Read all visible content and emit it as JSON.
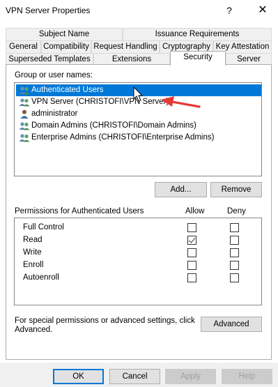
{
  "window": {
    "title": "VPN Server Properties",
    "help_glyph": "?",
    "close_glyph": "✕"
  },
  "tabs": {
    "row1": [
      "Subject Name",
      "Issuance Requirements"
    ],
    "row2": [
      "General",
      "Compatibility",
      "Request Handling",
      "Cryptography",
      "Key Attestation"
    ],
    "row3": [
      "Superseded Templates",
      "Extensions",
      "Security",
      "Server"
    ],
    "active": "Security"
  },
  "security": {
    "group_label": "Group or user names:",
    "users": [
      {
        "name": "Authenticated Users",
        "icon": "group-icon",
        "selected": true
      },
      {
        "name": "VPN Server (CHRISTOFI\\VPN Server)",
        "icon": "group-icon",
        "selected": false
      },
      {
        "name": "administrator",
        "icon": "user-icon",
        "selected": false
      },
      {
        "name": "Domain Admins (CHRISTOFI\\Domain Admins)",
        "icon": "group-icon",
        "selected": false
      },
      {
        "name": "Enterprise Admins (CHRISTOFI\\Enterprise Admins)",
        "icon": "group-icon",
        "selected": false
      }
    ],
    "add_label": "Add...",
    "remove_label": "Remove",
    "permissions_label": "Permissions for Authenticated Users",
    "allow_label": "Allow",
    "deny_label": "Deny",
    "permissions": [
      {
        "name": "Full Control",
        "allow": false,
        "deny": false
      },
      {
        "name": "Read",
        "allow": true,
        "deny": false
      },
      {
        "name": "Write",
        "allow": false,
        "deny": false
      },
      {
        "name": "Enroll",
        "allow": false,
        "deny": false
      },
      {
        "name": "Autoenroll",
        "allow": false,
        "deny": false
      }
    ],
    "special_text_line1": "For special permissions or advanced settings, click",
    "special_text_line2": "Advanced.",
    "advanced_label": "Advanced"
  },
  "footer": {
    "ok": "OK",
    "cancel": "Cancel",
    "apply": "Apply",
    "help": "Help"
  },
  "colors": {
    "selection": "#0078d7",
    "annotation_arrow": "#e53935"
  }
}
